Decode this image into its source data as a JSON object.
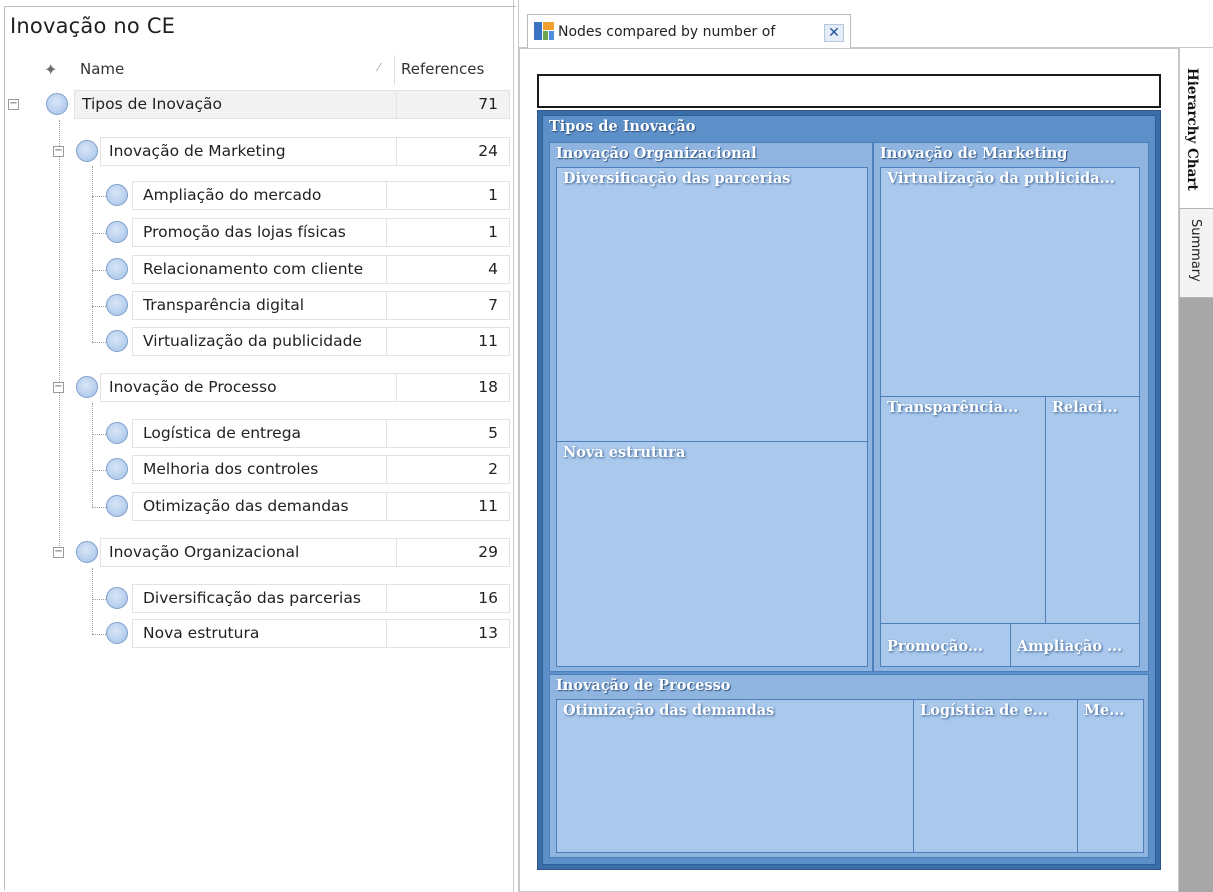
{
  "left_panel": {
    "title": "Inovação no CE",
    "columns": {
      "name": "Name",
      "references": "References"
    }
  },
  "tree": {
    "root": {
      "label": "Tipos de Inovação",
      "refs": "71"
    },
    "marketing": {
      "label": "Inovação de Marketing",
      "refs": "24"
    },
    "m1": {
      "label": "Ampliação do mercado",
      "refs": "1"
    },
    "m2": {
      "label": "Promoção das lojas físicas",
      "refs": "1"
    },
    "m3": {
      "label": "Relacionamento com cliente",
      "refs": "4"
    },
    "m4": {
      "label": "Transparência digital",
      "refs": "7"
    },
    "m5": {
      "label": "Virtualização da publicidade",
      "refs": "11"
    },
    "processo": {
      "label": "Inovação de Processo",
      "refs": "18"
    },
    "p1": {
      "label": "Logística de entrega",
      "refs": "5"
    },
    "p2": {
      "label": "Melhoria dos controles",
      "refs": "2"
    },
    "p3": {
      "label": "Otimização das demandas",
      "refs": "11"
    },
    "org": {
      "label": "Inovação Organizacional",
      "refs": "29"
    },
    "o1": {
      "label": "Diversificação das parcerias",
      "refs": "16"
    },
    "o2": {
      "label": "Nova estrutura",
      "refs": "13"
    }
  },
  "chart_tab": {
    "label": "Nodes compared by number of",
    "close": "✕"
  },
  "side_tabs": {
    "hierarchy": "Hierarchy Chart",
    "summary": "Summary"
  },
  "treemap": {
    "root": "Tipos de Inovação",
    "org": "Inovação Organizacional",
    "org_div": "Diversificação das parcerias",
    "org_nova": "Nova estrutura",
    "mkt": "Inovação de Marketing",
    "mkt_virt": "Virtualização da publicida...",
    "mkt_transp": "Transparência...",
    "mkt_relac": "Relaci...",
    "mkt_promo": "Promoção...",
    "mkt_ampl": "Ampliação ...",
    "proc": "Inovação de Processo",
    "proc_otim": "Otimização das demandas",
    "proc_log": "Logística de e...",
    "proc_me": "Me..."
  },
  "colors": {
    "treemap_frame": "#3b6ea8",
    "treemap_leaf": "#a9c8ec",
    "node_circle": "#b9d0ee"
  }
}
